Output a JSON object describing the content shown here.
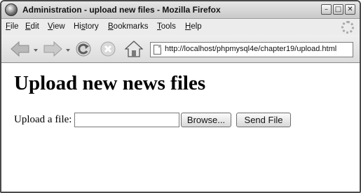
{
  "window": {
    "title": "Administration - upload new files - Mozilla Firefox",
    "controls": {
      "minimize": "–",
      "maximize": "□",
      "close": "✕"
    }
  },
  "menubar": {
    "items": [
      {
        "label": "File",
        "access": "F",
        "rest": "ile"
      },
      {
        "label": "Edit",
        "access": "E",
        "rest": "dit"
      },
      {
        "label": "View",
        "access": "V",
        "rest": "iew"
      },
      {
        "label": "History",
        "pre": "Hi",
        "access": "s",
        "rest": "tory"
      },
      {
        "label": "Bookmarks",
        "access": "B",
        "rest": "ookmarks"
      },
      {
        "label": "Tools",
        "access": "T",
        "rest": "ools"
      },
      {
        "label": "Help",
        "access": "H",
        "rest": "elp"
      }
    ]
  },
  "navbar": {
    "icons": [
      "back-icon",
      "forward-icon",
      "reload-icon",
      "stop-icon",
      "home-icon",
      "page-icon"
    ],
    "url": "http://localhost/phpmysql4e/chapter19/upload.html"
  },
  "page": {
    "heading": "Upload new news files",
    "upload_label": "Upload a file:",
    "file_value": "",
    "browse_label": "Browse...",
    "send_label": "Send File"
  }
}
